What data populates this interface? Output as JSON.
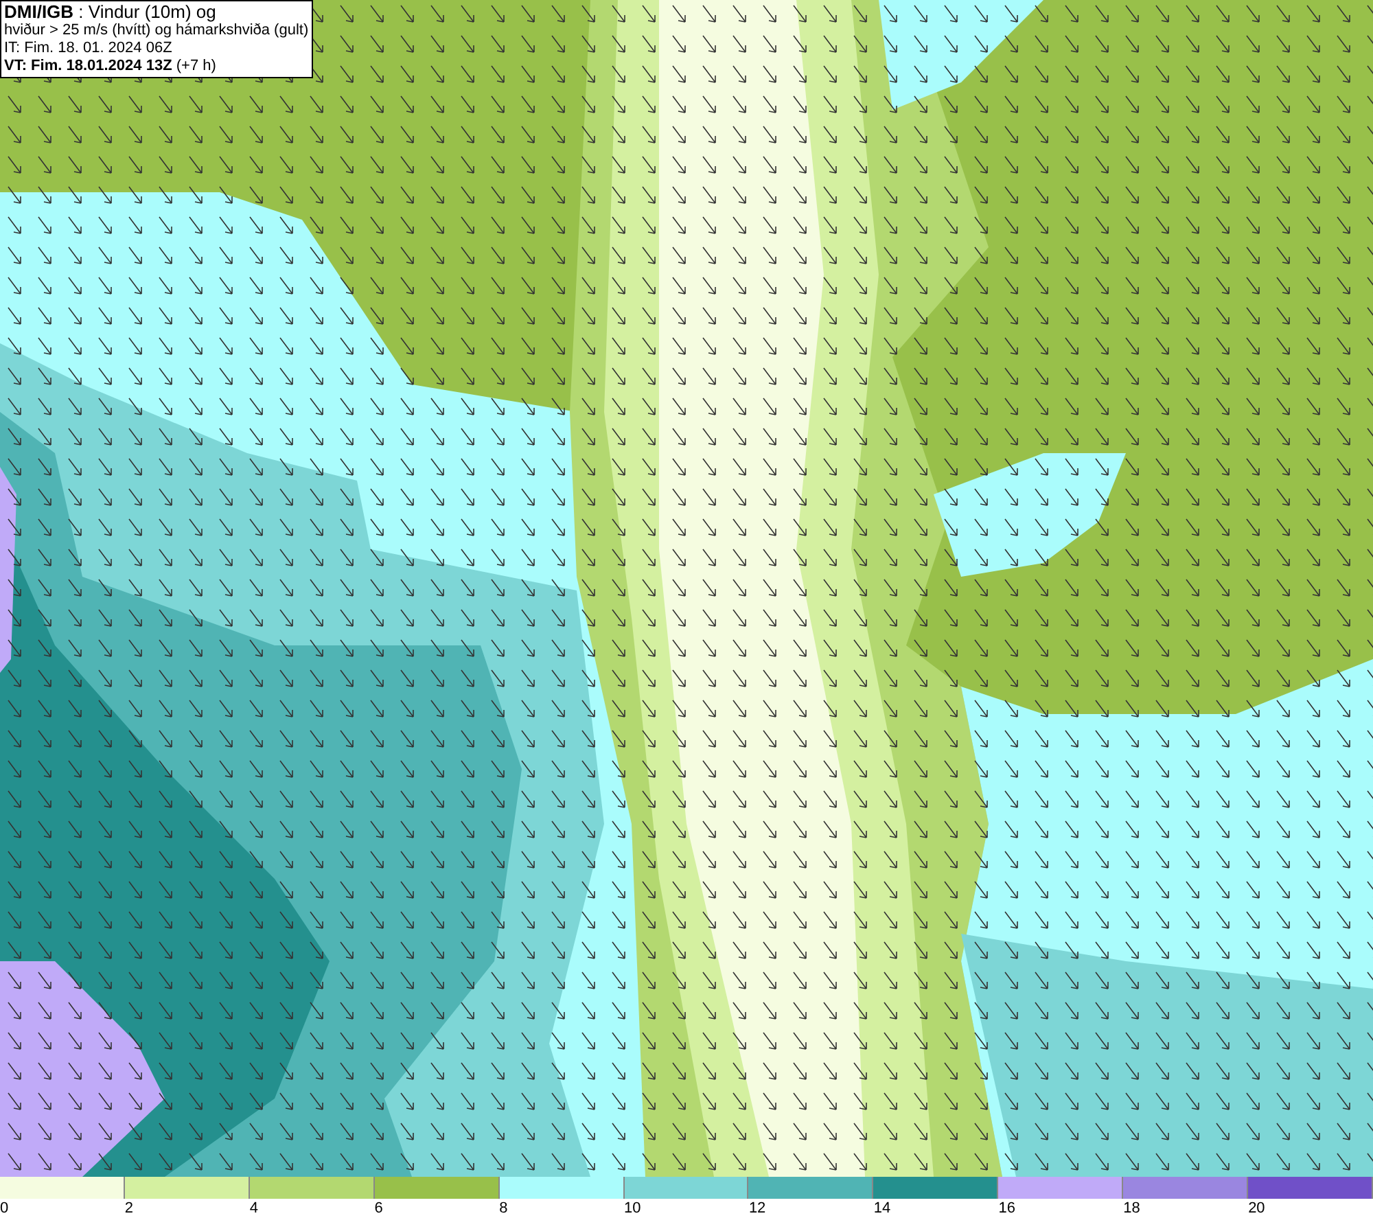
{
  "header": {
    "lines": [
      "**DMI/IGB** : Vindur (10m) og",
      "hviður > 25 m/s (hvítt) og hámarkshviða (gult)",
      "IT: Fim. 18. 01. 2024 06Z",
      "**VT: Fim. 18.01.2024 13Z** (+7 h)"
    ]
  },
  "legend": {
    "swatches": [
      {
        "color": "#f5fce0"
      },
      {
        "color": "#d4f0a0"
      },
      {
        "color": "#b3d870"
      },
      {
        "color": "#98c04a"
      },
      {
        "color": "#aafcfc"
      },
      {
        "color": "#7dd6d6"
      },
      {
        "color": "#50b4b4"
      },
      {
        "color": "#24908e"
      },
      {
        "color": "#c0aaf8"
      },
      {
        "color": "#9a86e0"
      },
      {
        "color": "#7050c8"
      }
    ],
    "labels": [
      "0",
      "2",
      "4",
      "6",
      "8",
      "10",
      "12",
      "14",
      "16",
      "18",
      "20"
    ]
  }
}
